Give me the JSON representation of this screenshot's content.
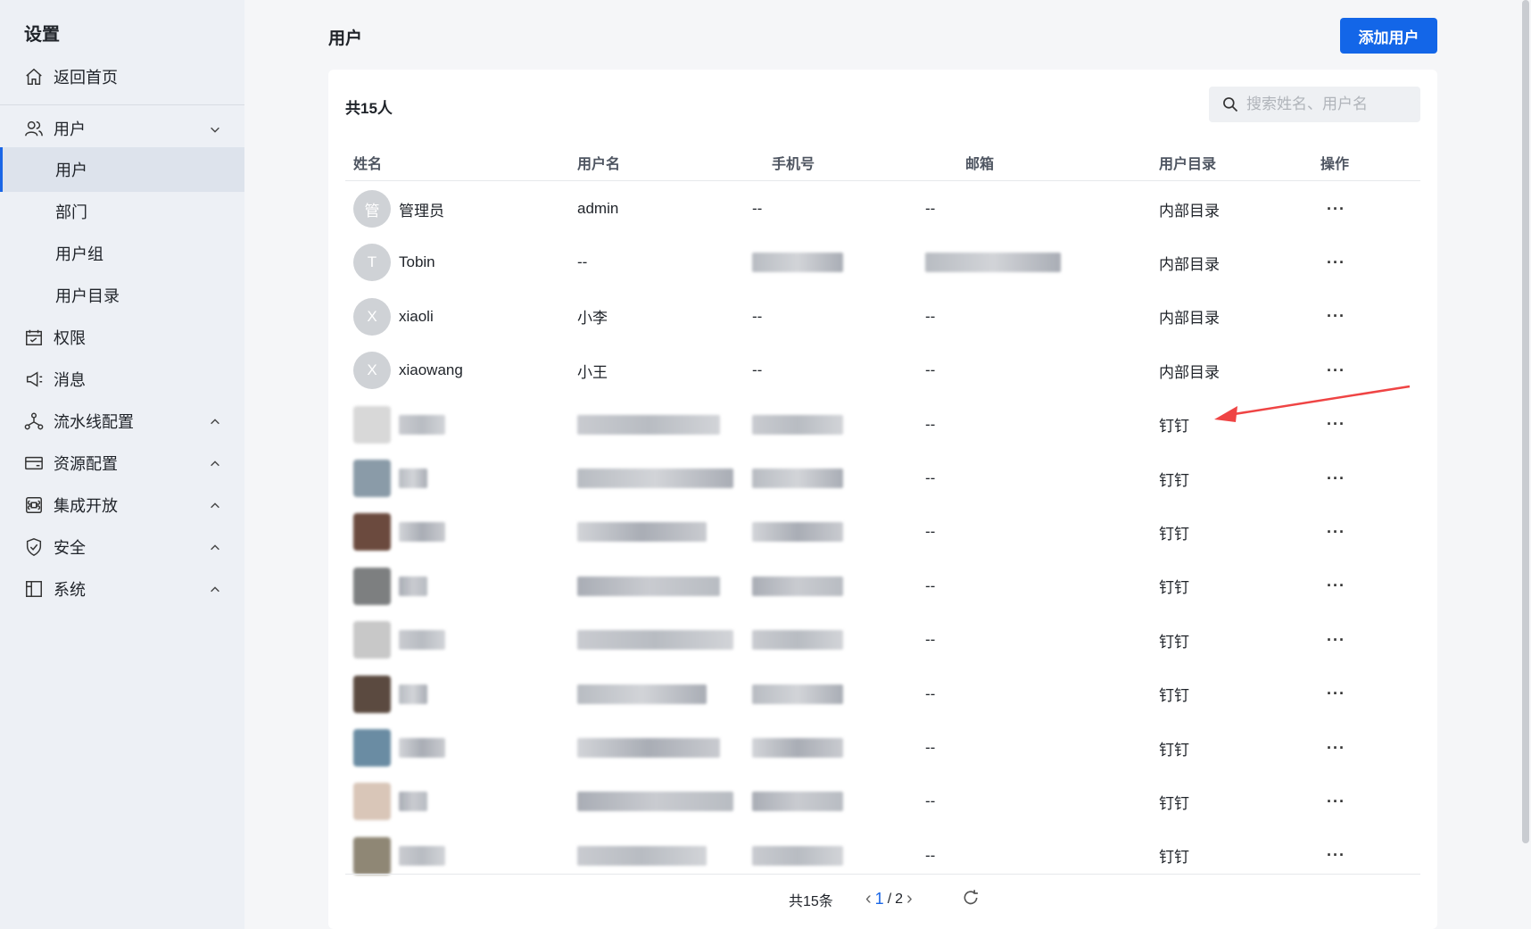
{
  "sidebar": {
    "title": "设置",
    "home": "返回首页",
    "users_group": "用户",
    "sub_items": [
      "用户",
      "部门",
      "用户组",
      "用户目录"
    ],
    "items": [
      "权限",
      "消息",
      "流水线配置",
      "资源配置",
      "集成开放",
      "安全",
      "系统"
    ]
  },
  "header": {
    "title": "用户",
    "add_button": "添加用户"
  },
  "card": {
    "count": "共15人",
    "search_placeholder": "搜索姓名、用户名",
    "columns": [
      "姓名",
      "用户名",
      "手机号",
      "邮箱",
      "用户目录",
      "操作"
    ],
    "rows": [
      {
        "avatar": "管",
        "name": "管理员",
        "username": "admin",
        "phone": "--",
        "email": "--",
        "directory": "内部目录",
        "action": "···"
      },
      {
        "avatar": "T",
        "name": "Tobin",
        "username": "--",
        "phone": "",
        "email": "",
        "directory": "内部目录",
        "action": "···"
      },
      {
        "avatar": "X",
        "name": "xiaoli",
        "username": "小李",
        "phone": "--",
        "email": "--",
        "directory": "内部目录",
        "action": "···"
      },
      {
        "avatar": "X",
        "name": "xiaowang",
        "username": "小王",
        "phone": "--",
        "email": "--",
        "directory": "内部目录",
        "action": "···"
      },
      {
        "avatar": "",
        "name": "",
        "username": "",
        "phone": "",
        "email": "--",
        "directory": "钉钉",
        "action": "···"
      },
      {
        "avatar": "",
        "name": "",
        "username": "",
        "phone": "",
        "email": "--",
        "directory": "钉钉",
        "action": "···"
      },
      {
        "avatar": "",
        "name": "",
        "username": "",
        "phone": "",
        "email": "--",
        "directory": "钉钉",
        "action": "···"
      },
      {
        "avatar": "",
        "name": "",
        "username": "",
        "phone": "",
        "email": "--",
        "directory": "钉钉",
        "action": "···"
      },
      {
        "avatar": "",
        "name": "",
        "username": "",
        "phone": "",
        "email": "--",
        "directory": "钉钉",
        "action": "···"
      },
      {
        "avatar": "",
        "name": "",
        "username": "",
        "phone": "",
        "email": "--",
        "directory": "钉钉",
        "action": "···"
      },
      {
        "avatar": "",
        "name": "",
        "username": "",
        "phone": "",
        "email": "--",
        "directory": "钉钉",
        "action": "···"
      },
      {
        "avatar": "",
        "name": "",
        "username": "",
        "phone": "",
        "email": "--",
        "directory": "钉钉",
        "action": "···"
      },
      {
        "avatar": "",
        "name": "",
        "username": "",
        "phone": "",
        "email": "--",
        "directory": "钉钉",
        "action": "···"
      }
    ]
  },
  "pagination": {
    "total": "共15条",
    "current": "1",
    "separator": "/",
    "pages": "2"
  },
  "colors": {
    "primary": "#1366e8",
    "annotation_arrow": "#ef4444"
  }
}
